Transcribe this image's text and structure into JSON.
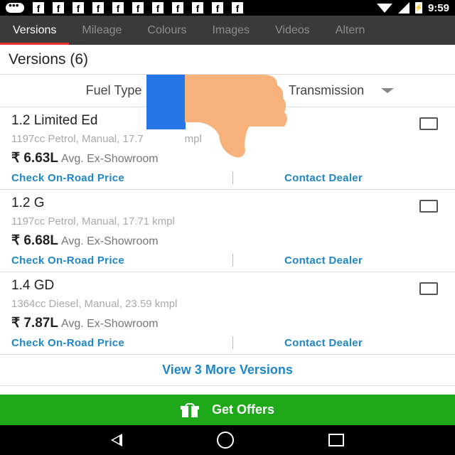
{
  "status_bar": {
    "time": "9:59",
    "notification_icons": [
      "chat-icon",
      "facebook-icon",
      "facebook-icon",
      "facebook-icon",
      "facebook-icon",
      "facebook-icon",
      "facebook-icon",
      "facebook-icon",
      "facebook-icon",
      "facebook-icon",
      "facebook-icon",
      "facebook-icon"
    ]
  },
  "tabs": [
    "Versions",
    "Mileage",
    "Colours",
    "Images",
    "Videos",
    "Altern"
  ],
  "versions_header": "Versions (6)",
  "filters": {
    "fuel_type": "Fuel Type",
    "transmission": "Transmission"
  },
  "versions": [
    {
      "name": "1.2 Limited Ed",
      "spec": "1197cc Petrol, Manual, 17.7",
      "spec_tail": "mpl",
      "price": "₹ 6.63L",
      "price_note": "Avg. Ex-Showroom",
      "onroad": "Check On-Road Price",
      "dealer": "Contact Dealer"
    },
    {
      "name": "1.2 G",
      "spec": "1197cc Petrol, Manual, 17.71 kmpl",
      "price": "₹ 6.68L",
      "price_note": "Avg. Ex-Showroom",
      "onroad": "Check On-Road Price",
      "dealer": "Contact Dealer"
    },
    {
      "name": "1.4 GD",
      "spec": "1364cc Diesel, Manual, 23.59 kmpl",
      "price": "₹ 7.87L",
      "price_note": "Avg. Ex-Showroom",
      "onroad": "Check On-Road Price",
      "dealer": "Contact Dealer"
    }
  ],
  "view_more": "View 3 More Versions",
  "offers_button": "Get Offers",
  "colors": {
    "tab_bg": "#3a3a3a",
    "tab_active_indicator": "#e8322e",
    "link": "#1f86c8",
    "offers_bg": "#1ea81a",
    "overlay_blue": "#1a6fe8",
    "overlay_thumb": "#f6b27a"
  },
  "overlay": {
    "icons": [
      "blue-block",
      "thumbs-down-icon"
    ]
  }
}
